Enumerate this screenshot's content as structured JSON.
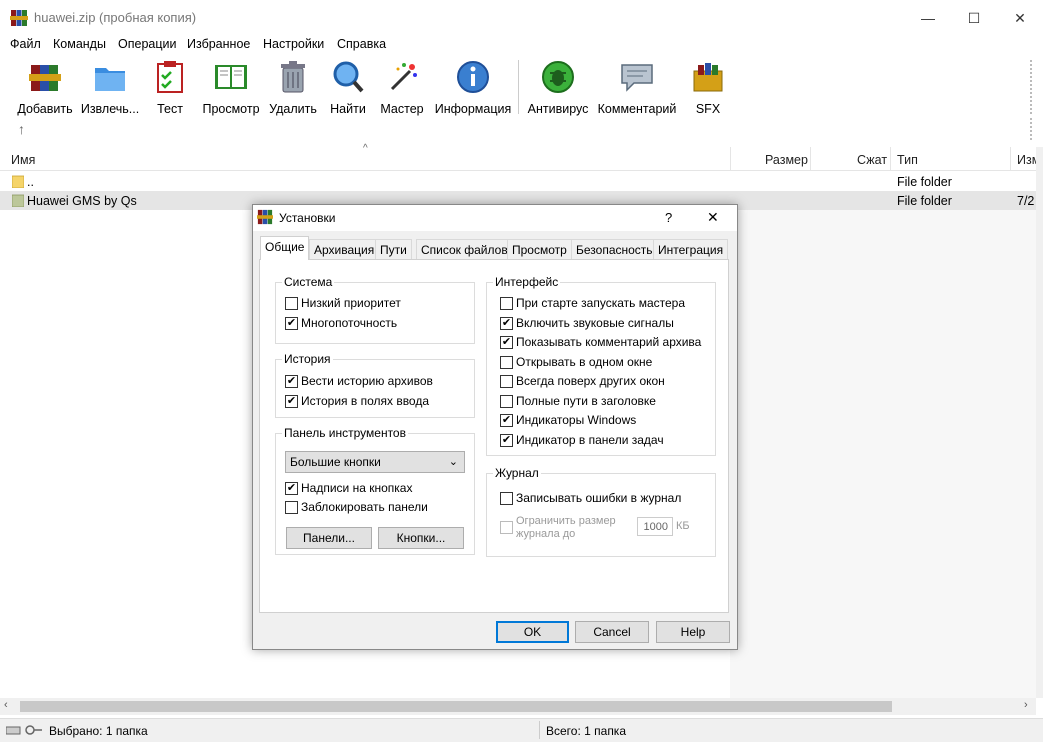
{
  "window": {
    "title": "huawei.zip (пробная копия)",
    "minimize_glyph": "—",
    "maximize_glyph": "☐",
    "close_glyph": "✕"
  },
  "menu": [
    "Файл",
    "Команды",
    "Операции",
    "Избранное",
    "Настройки",
    "Справка"
  ],
  "toolbar": {
    "buttons": [
      {
        "label": "Добавить",
        "icon": "add-archive-icon"
      },
      {
        "label": "Извлечь...",
        "icon": "extract-folder-icon"
      },
      {
        "label": "Тест",
        "icon": "test-clipboard-icon"
      },
      {
        "label": "Просмотр",
        "icon": "view-book-icon"
      },
      {
        "label": "Удалить",
        "icon": "trash-icon"
      },
      {
        "label": "Найти",
        "icon": "search-icon"
      },
      {
        "label": "Мастер",
        "icon": "wizard-wand-icon"
      },
      {
        "label": "Информация",
        "icon": "info-icon"
      },
      {
        "label": "Антивирус",
        "icon": "antivirus-bug-icon"
      },
      {
        "label": "Комментарий",
        "icon": "comment-icon"
      },
      {
        "label": "SFX",
        "icon": "sfx-box-icon"
      }
    ],
    "up_glyph": "↑"
  },
  "filelist": {
    "columns": [
      "Имя",
      "Размер",
      "Сжат",
      "Тип",
      "Изм"
    ],
    "sort_glyph": "^",
    "rows": [
      {
        "name": "..",
        "type": "File folder",
        "modified": ""
      },
      {
        "name": "Huawei GMS by Qs",
        "type": "File folder",
        "modified": "7/2"
      }
    ]
  },
  "statusbar": {
    "left": "Выбрано: 1 папка",
    "right": "Всего: 1 папка"
  },
  "dialog": {
    "title": "Установки",
    "help_glyph": "?",
    "close_glyph": "✕",
    "tabs": [
      "Общие",
      "Архивация",
      "Пути",
      "Список файлов",
      "Просмотр",
      "Безопасность",
      "Интеграция"
    ],
    "system": {
      "title": "Система",
      "items": [
        {
          "label": "Низкий приоритет",
          "checked": false
        },
        {
          "label": "Многопоточность",
          "checked": true
        }
      ]
    },
    "history": {
      "title": "История",
      "items": [
        {
          "label": "Вести историю архивов",
          "checked": true
        },
        {
          "label": "История в полях ввода",
          "checked": true
        }
      ]
    },
    "toolbar_group": {
      "title": "Панель инструментов",
      "combo_value": "Большие кнопки",
      "items": [
        {
          "label": "Надписи на кнопках",
          "checked": true
        },
        {
          "label": "Заблокировать панели",
          "checked": false
        }
      ],
      "panels_button": "Панели...",
      "buttons_button": "Кнопки..."
    },
    "interface": {
      "title": "Интерфейс",
      "items": [
        {
          "label": "При старте запускать мастера",
          "checked": false
        },
        {
          "label": "Включить звуковые сигналы",
          "checked": true
        },
        {
          "label": "Показывать комментарий архива",
          "checked": true
        },
        {
          "label": "Открывать в одном окне",
          "checked": false
        },
        {
          "label": "Всегда поверх других окон",
          "checked": false
        },
        {
          "label": "Полные пути в заголовке",
          "checked": false
        },
        {
          "label": "Индикаторы Windows",
          "checked": true
        },
        {
          "label": "Индикатор в панели задач",
          "checked": true
        }
      ]
    },
    "journal": {
      "title": "Журнал",
      "log_errors": {
        "label": "Записывать ошибки в журнал",
        "checked": false
      },
      "limit_line1": "Ограничить размер",
      "limit_line2": "журнала до",
      "limit_value": "1000",
      "limit_unit": "КБ"
    },
    "ok": "OK",
    "cancel": "Cancel",
    "help": "Help"
  }
}
